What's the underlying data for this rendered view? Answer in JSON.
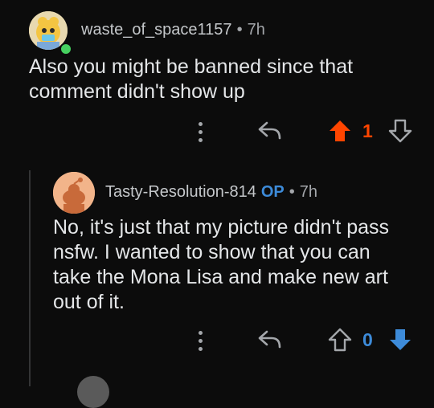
{
  "comments": [
    {
      "username": "waste_of_space1157",
      "time": "7h",
      "text": "Also you might be banned since that comment didn't show up",
      "vote_count": "1",
      "vote_state": "upvoted"
    },
    {
      "username": "Tasty-Resolution-814",
      "op_badge": "OP",
      "time": "7h",
      "text": "No, it's just that my picture didn't pass nsfw. I wanted to show that you can take the Mona Lisa and make new art out of it.",
      "vote_count": "0",
      "vote_state": "downvoted"
    }
  ],
  "separator": "•",
  "colors": {
    "upvote": "#ff4500",
    "downvote": "#3d8bd9",
    "online": "#46d160"
  }
}
